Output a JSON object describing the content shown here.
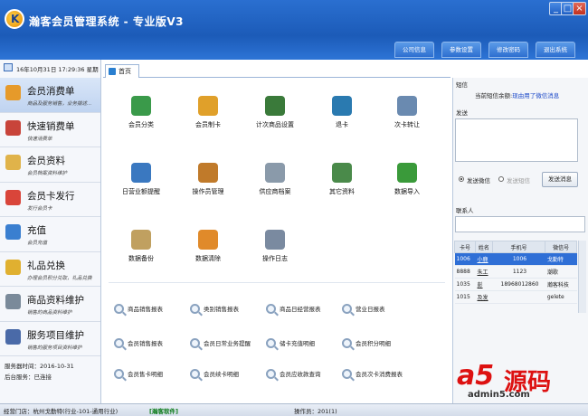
{
  "app": {
    "title": "瀚客会员管理系统 - 专业版V3",
    "window_buttons": [
      "minimize",
      "maximize",
      "close"
    ]
  },
  "top_nav": [
    "公司信息",
    "参数设置",
    "修改密码",
    "退出系统"
  ],
  "sidebar": {
    "datetime": "16年10月31日 17:29:36 星期一",
    "items": [
      {
        "label": "会员消费单",
        "sub": "商品及服务销售，业务描述...",
        "icon": "cart-icon",
        "color": "#e69a2a"
      },
      {
        "label": "快速销费单",
        "sub": "快速消费单",
        "icon": "house-icon",
        "color": "#c8443a"
      },
      {
        "label": "会员资料",
        "sub": "会员档案资料维护",
        "icon": "users-icon",
        "color": "#e0b34a"
      },
      {
        "label": "会员卡发行",
        "sub": "发行会员卡",
        "icon": "card-icon",
        "color": "#d9453a"
      },
      {
        "label": "充值",
        "sub": "会员充值",
        "icon": "coins-icon",
        "color": "#3a7fd0"
      },
      {
        "label": "礼品兑换",
        "sub": "办理会员积分兑取，礼品兑换",
        "icon": "gift-icon",
        "color": "#e0b030"
      },
      {
        "label": "商品资料维护",
        "sub": "销售的商品资料维护",
        "icon": "goods-icon",
        "color": "#7a8a9a"
      },
      {
        "label": "服务项目维护",
        "sub": "销售的服务项目资料维护",
        "icon": "service-icon",
        "color": "#4a6aa8"
      }
    ],
    "server_time_label": "服务器时间：2016-10-31",
    "backend_label": "后台服务：已连接"
  },
  "tabs": [
    "首页"
  ],
  "main_icons": [
    {
      "label": "会员分类",
      "icon": "gear-icon",
      "color": "#3a9a4a"
    },
    {
      "label": "会员制卡",
      "icon": "card-make-icon",
      "color": "#e0a02a"
    },
    {
      "label": "计次商品设置",
      "icon": "person-icon",
      "color": "#3a7a3a"
    },
    {
      "label": "退卡",
      "icon": "return-card-icon",
      "color": "#2a7ab0"
    },
    {
      "label": "次卡转让",
      "icon": "transfer-icon",
      "color": "#6a8ab0"
    },
    {
      "label": "日营业额提醒",
      "icon": "reminder-icon",
      "color": "#3a78c0"
    },
    {
      "label": "操作员管理",
      "icon": "operator-icon",
      "color": "#c07a2a"
    },
    {
      "label": "供应商档案",
      "icon": "supplier-icon",
      "color": "#8a9aaa"
    },
    {
      "label": "其它资料",
      "icon": "other-data-icon",
      "color": "#4a8a4a"
    },
    {
      "label": "数据导入",
      "icon": "import-icon",
      "color": "#3a9a3a"
    },
    {
      "label": "数据备份",
      "icon": "backup-icon",
      "color": "#c0a060"
    },
    {
      "label": "数据清除",
      "icon": "clear-icon",
      "color": "#e08a2a"
    },
    {
      "label": "操作日志",
      "icon": "log-icon",
      "color": "#7a8aa0"
    }
  ],
  "reports": [
    "商品销售报表",
    "类别销售报表",
    "商品日经营报表",
    "营业日报表",
    "会员销售报表",
    "会员日常业务提醒",
    "储卡充值明细",
    "会员积分明细",
    "会员售卡明细",
    "会员续卡明细",
    "会员应收款查询",
    "会员次卡消费报表"
  ],
  "right_panel": {
    "sms_label": "短信",
    "balance_label": "当前短信余额:",
    "balance_link": "现由用了微信消息",
    "send_label": "发送",
    "radio_wechat": "发送微信",
    "radio_sms": "发送短信",
    "send_button": "发送消息",
    "contacts_label": "联系人",
    "contacts_headers": [
      "卡号",
      "姓名",
      "手机号",
      "微信号"
    ],
    "contacts": [
      {
        "card": "1006",
        "name": "小鹿",
        "phone": "1006",
        "wechat": "戈勤特"
      },
      {
        "card": "8888",
        "name": "朱工",
        "phone": "1123",
        "wechat": "潮歌"
      },
      {
        "card": "1035",
        "name": "彭",
        "phone": "18968012860",
        "wechat": "瀚客科技"
      },
      {
        "card": "1015",
        "name": "及发",
        "phone": "",
        "wechat": "gelete"
      }
    ]
  },
  "status_bar": {
    "store": "经营门店：杭州戈勤特(行业-101-通用行业)",
    "software": "[瀚客软件]",
    "operator": "操作员：201(1)"
  },
  "watermark": {
    "brand": "a5",
    "brand_cn": "源码",
    "url": "admin5.com"
  },
  "colors": {
    "titlebar": "#1c5bb8",
    "selected_row": "#2f6fd6",
    "active_sidebar": "#bfd3f0"
  }
}
